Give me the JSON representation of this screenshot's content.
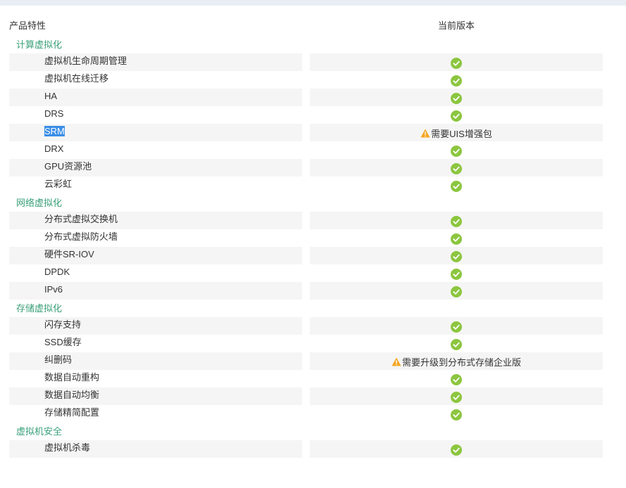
{
  "header": {
    "col_feature": "产品特性",
    "col_version": "当前版本"
  },
  "colors": {
    "section_title": "#3aa07a",
    "check": "#8cc63f",
    "warning": "#f5a623",
    "row_shade": "#f5f5f5",
    "selection": "#3a8ee6"
  },
  "sections": [
    {
      "title": "计算虚拟化",
      "rows": [
        {
          "feature": "虚拟机生命周期管理",
          "status": "check"
        },
        {
          "feature": "虚拟机在线迁移",
          "status": "check"
        },
        {
          "feature": "HA",
          "status": "check"
        },
        {
          "feature": "DRS",
          "status": "check"
        },
        {
          "feature": "SRM",
          "status": "warning",
          "note": "需要UIS增强包",
          "selected": true
        },
        {
          "feature": "DRX",
          "status": "check"
        },
        {
          "feature": "GPU资源池",
          "status": "check"
        },
        {
          "feature": "云彩虹",
          "status": "check"
        }
      ]
    },
    {
      "title": "网络虚拟化",
      "rows": [
        {
          "feature": "分布式虚拟交换机",
          "status": "check"
        },
        {
          "feature": "分布式虚拟防火墙",
          "status": "check"
        },
        {
          "feature": "硬件SR-IOV",
          "status": "check"
        },
        {
          "feature": "DPDK",
          "status": "check"
        },
        {
          "feature": "IPv6",
          "status": "check"
        }
      ]
    },
    {
      "title": "存储虚拟化",
      "rows": [
        {
          "feature": "闪存支持",
          "status": "check"
        },
        {
          "feature": "SSD缓存",
          "status": "check"
        },
        {
          "feature": "纠删码",
          "status": "warning",
          "note": "需要升级到分布式存储企业版"
        },
        {
          "feature": "数据自动重构",
          "status": "check"
        },
        {
          "feature": "数据自动均衡",
          "status": "check"
        },
        {
          "feature": "存储精简配置",
          "status": "check"
        }
      ]
    },
    {
      "title": "虚拟机安全",
      "rows": [
        {
          "feature": "虚拟机杀毒",
          "status": "check"
        }
      ]
    }
  ]
}
